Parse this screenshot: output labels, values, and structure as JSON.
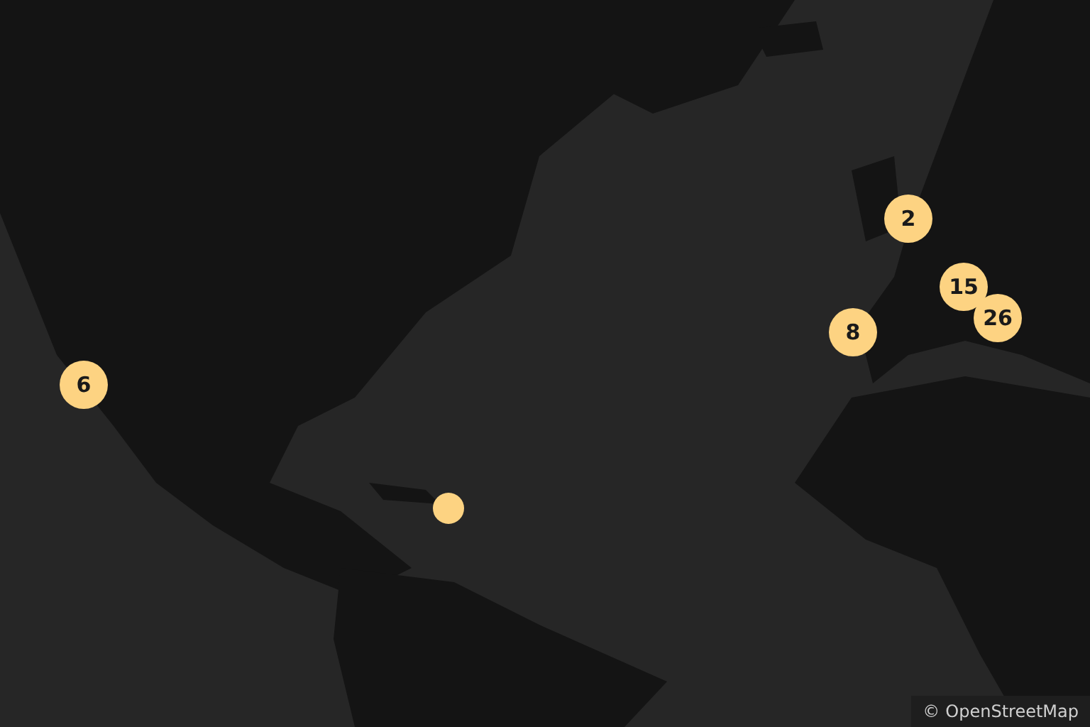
{
  "markers": [
    {
      "kind": "cluster",
      "count": "2"
    },
    {
      "kind": "cluster",
      "count": "15"
    },
    {
      "kind": "cluster",
      "count": "26"
    },
    {
      "kind": "cluster",
      "count": "8"
    },
    {
      "kind": "cluster",
      "count": "6"
    },
    {
      "kind": "point"
    }
  ],
  "attribution": {
    "prefix": "©",
    "link": "OpenStreetMap"
  }
}
